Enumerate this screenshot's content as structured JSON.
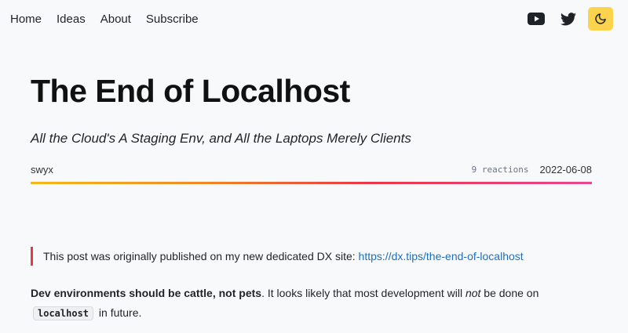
{
  "nav": {
    "links": [
      "Home",
      "Ideas",
      "About",
      "Subscribe"
    ],
    "icons": [
      "youtube-icon",
      "twitter-icon",
      "moon-icon"
    ],
    "accent": "#fcd34d"
  },
  "article": {
    "title": "The End of Localhost",
    "subtitle": "All the Cloud's A Staging Env, and All the Laptops Merely Clients",
    "author": "swyx",
    "reactions": "9 reactions",
    "date": "2022-06-08",
    "callout_text": "This post was originally published on my new dedicated DX site: ",
    "callout_link": "https://dx.tips/the-end-of-localhost",
    "para_bold": "Dev environments should be cattle, not pets",
    "para_text_1": ". It looks likely that most development will ",
    "para_em": "not",
    "para_text_2": " be done on ",
    "para_code": "localhost",
    "para_text_3": " in future."
  },
  "colors": {
    "gradient": [
      "#f5b81c",
      "#f08a24",
      "#e63946",
      "#e8468f"
    ],
    "link": "#1e6fba",
    "callout_border": "#e63946"
  }
}
